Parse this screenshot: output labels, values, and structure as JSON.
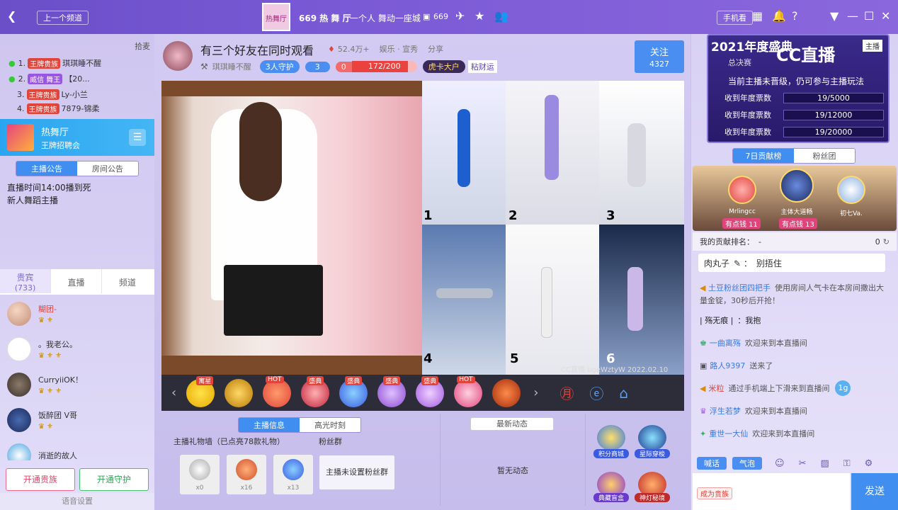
{
  "titlebar": {
    "prev_channel": "上一个频道",
    "room_title": "669 热 舞 厅",
    "room_slogan": "一个人 舞动一座城",
    "room_count": "669",
    "phone_label": "手机看",
    "logo_text": "热舞厅"
  },
  "left": {
    "header_label": "拾麦",
    "ranks": [
      {
        "no": "1.",
        "title": "王牌贵族",
        "name": "琪琪睡不醒"
      },
      {
        "no": "2.",
        "title": "威信 舞王",
        "name": "【20..."
      },
      {
        "no": "3.",
        "title": "王牌贵族",
        "name": "Ly-小兰"
      },
      {
        "no": "4.",
        "title": "王牌贵族",
        "name": "7879-锦柔"
      }
    ],
    "channel_name": "热舞厅",
    "channel_sub": "王牌招聘会",
    "notice_tabs": [
      "主播公告",
      "房间公告"
    ],
    "notice_text_1": "直播时间14:00播到死",
    "notice_text_2": "新人舞蹈主播",
    "user_tabs": [
      "贵宾",
      "直播",
      "频道"
    ],
    "vip_count": "(733)",
    "users": [
      {
        "name": "糊团-"
      },
      {
        "name": "。我老公。"
      },
      {
        "name": "CurryiiOK！"
      },
      {
        "name": "饭醉团 V哥"
      },
      {
        "name": "消逝的故人"
      }
    ],
    "open_noble": "开通贵族",
    "open_guard": "开通守护",
    "voice_settings": "语音设置"
  },
  "center": {
    "stream_title": "有三个好友在同时观看",
    "popularity": "52.4万+",
    "category": "娱乐 · 宣秀",
    "share": "分享",
    "anchor_name": "琪琪睡不醒",
    "guard_label": "3人守护",
    "fans_count": "3",
    "level_value": "0",
    "progress_text": "172/200",
    "progress_pct": 86,
    "tiger_card": "虎卡大户",
    "sticky_luck": "粘财运",
    "follow_label": "关注",
    "follow_count": "4327",
    "panel_numbers": [
      "1",
      "2",
      "3",
      "4",
      "5",
      "6"
    ],
    "watermark": "CC直播 bgeWztyW 2022.02.10",
    "gift_tags": [
      "寓星",
      "HOT",
      "盛典",
      "盛典",
      "盛典",
      "盛典",
      "HOT"
    ],
    "info_tabs": [
      "主播信息",
      "高光时刻"
    ],
    "latest_tab": "最新动态",
    "gift_wall": "主播礼物墙（已点亮78款礼物）",
    "fan_group": "粉丝群",
    "gift_counts": [
      "x0",
      "x16",
      "x13"
    ],
    "fan_group_empty": "主播未设置粉丝群",
    "no_feed": "暂无动态",
    "mall_label": "积分商城",
    "star_label": "星际穿梭",
    "treasure_label": "典藏盲盒",
    "lamp_label": "神灯秘境"
  },
  "right": {
    "banner_year": "2021年度盛典",
    "banner_stage": "总决赛",
    "cc_brand": "CC直播",
    "anchor_tab": "主播",
    "hint": "当前主播未晋级，仍可参与主播玩法",
    "votes": [
      {
        "label": "收到年度票数",
        "value": "19/5000"
      },
      {
        "label": "收到年度票数",
        "value": "19/12000"
      },
      {
        "label": "收到年度票数",
        "value": "19/20000"
      }
    ],
    "rank_tabs": [
      "7日贡献榜",
      "粉丝团"
    ],
    "top3": [
      {
        "name": "Mrlingcc",
        "score": "有点钱 11"
      },
      {
        "name": "主体大道畅",
        "score": "有点钱 13"
      },
      {
        "name": "初七Va.",
        "score": ""
      }
    ],
    "my_rank": "我的贡献排名：",
    "my_rank_dash": "-",
    "my_rank_value": "0",
    "chat_top": "肉丸子",
    "chat_top_msg": "别捂住",
    "chat": [
      {
        "name": "土豆粉丝团四把手",
        "text": "使用房间人气卡在本房间撒出大量金锭，30秒后开抢！"
      },
      {
        "name": "| 殇无痕 |",
        "text": "：我抱"
      },
      {
        "name": "一曲离殇",
        "text": "欢迎来到本直播间"
      },
      {
        "name": "路人9397",
        "text": "送来了"
      },
      {
        "name": "米粒",
        "text": "通过手机端上下滑来到直播间"
      },
      {
        "name": "浮生若梦",
        "text": "欢迎来到本直播间"
      },
      {
        "name": "重世一大仙",
        "text": "欢迎来到本直播间"
      }
    ],
    "bubble_1g": "1g",
    "input_tabs": [
      "喊话",
      "气泡"
    ],
    "become_noble": "成为贵族",
    "send": "发送"
  }
}
